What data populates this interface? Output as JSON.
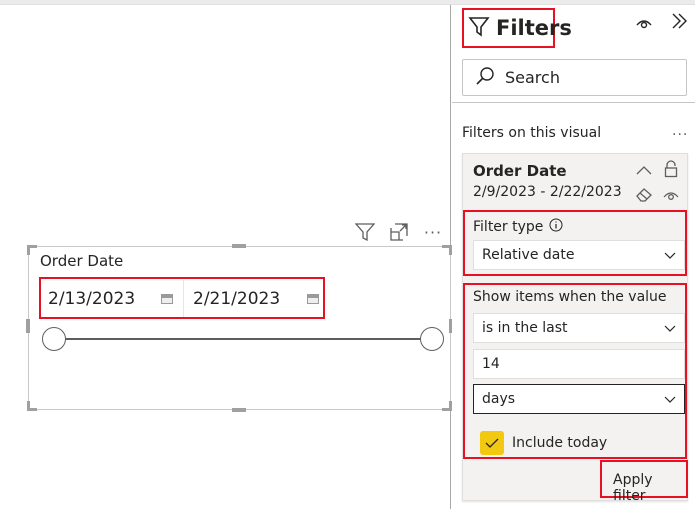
{
  "canvas": {
    "visual_header": {
      "filter_icon": "filter-icon",
      "focus_icon": "focus-mode-icon",
      "more_icon": "more-options-icon"
    },
    "slicer": {
      "title": "Order Date",
      "start_date": "2/13/2023",
      "end_date": "2/21/2023",
      "calendar_icon": "calendar-icon",
      "range_start_fraction": 0.0,
      "range_end_fraction": 1.0
    }
  },
  "filter_pane": {
    "title": "Filters",
    "search_placeholder": "Search",
    "section_label": "Filters on this visual",
    "more_label": "...",
    "card": {
      "field": "Order Date",
      "summary": "2/9/2023 - 2/22/2023",
      "filter_type_label": "Filter type",
      "filter_type_value": "Relative date",
      "show_items_label": "Show items when the value",
      "operator_value": "is in the last",
      "amount_value": "14",
      "unit_value": "days",
      "include_today_label": "Include today",
      "include_today_checked": true,
      "apply_label": "Apply filter"
    }
  },
  "colors": {
    "highlight": "#e81123",
    "checkbox": "#f2c811",
    "card_bg": "#f3f2f1"
  }
}
